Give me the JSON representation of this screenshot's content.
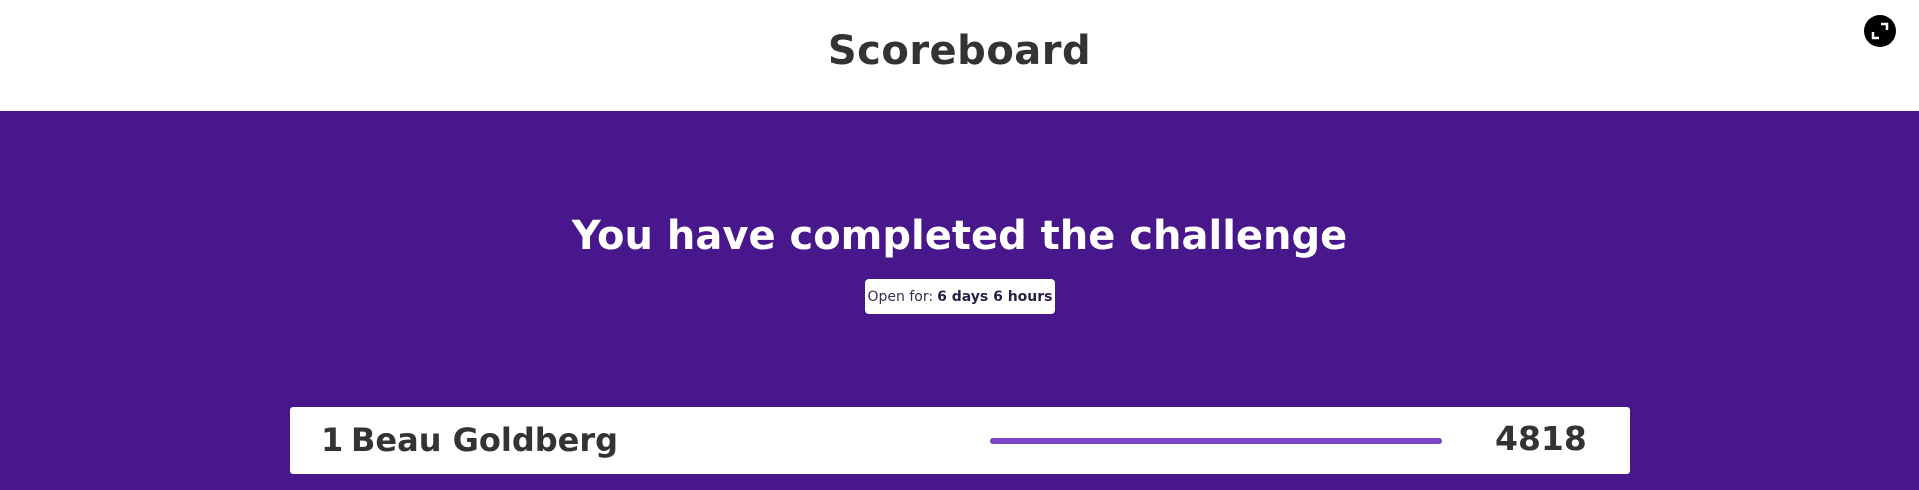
{
  "header": {
    "title": "Scoreboard",
    "fullscreen_icon": "fullscreen-exit-icon"
  },
  "main": {
    "heading": "You have completed the challenge",
    "open_for": {
      "label": "Open for:",
      "value": "6 days 6 hours"
    }
  },
  "leaderboard": [
    {
      "rank": "1",
      "name": "Beau Goldberg",
      "progress": 1.0,
      "score": "4818"
    }
  ],
  "colors": {
    "background": "#48178c",
    "progress": "#7b45c9",
    "text_dark": "#333333"
  }
}
